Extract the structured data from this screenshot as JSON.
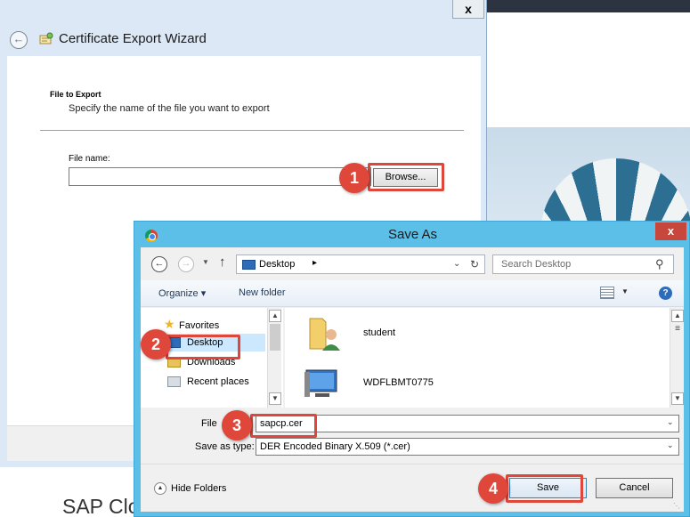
{
  "background": {
    "partial_heading": "SAP Clo"
  },
  "wizard": {
    "title": "Certificate Export Wizard",
    "close_label": "x",
    "section_title": "File to Export",
    "section_subtitle": "Specify the name of the file you want to export",
    "file_name_label": "File name:",
    "file_name_value": "",
    "browse_label": "Browse..."
  },
  "dialog": {
    "title": "Save As",
    "close_label": "x",
    "address": {
      "location": "Desktop",
      "separator": "▸"
    },
    "search_placeholder": "Search Desktop",
    "toolbar": {
      "organize_label": "Organize ▾",
      "new_folder_label": "New folder",
      "help_label": "?"
    },
    "nav": {
      "favorites_label": "Favorites",
      "items": [
        {
          "label": "Desktop",
          "icon": "desktop-folder-icon",
          "selected": true
        },
        {
          "label": "Downloads",
          "icon": "downloads-folder-icon",
          "selected": false
        },
        {
          "label": "Recent places",
          "icon": "recent-places-icon",
          "selected": false
        }
      ]
    },
    "files": [
      {
        "name": "student",
        "icon": "user-folder-icon"
      },
      {
        "name": "WDFLBMT0775",
        "icon": "computer-icon"
      }
    ],
    "file_name_label": "File",
    "file_name_value": "sapcp.cer",
    "save_type_label": "Save as type:",
    "save_type_value": "DER Encoded Binary X.509 (*.cer)",
    "hide_folders_label": "Hide Folders",
    "save_label": "Save",
    "cancel_label": "Cancel"
  },
  "markers": [
    "1",
    "2",
    "3",
    "4"
  ],
  "colors": {
    "highlight": "#e0473b",
    "dialog_frame": "#5cbfe8",
    "wizard_frame": "#dce8f5"
  }
}
